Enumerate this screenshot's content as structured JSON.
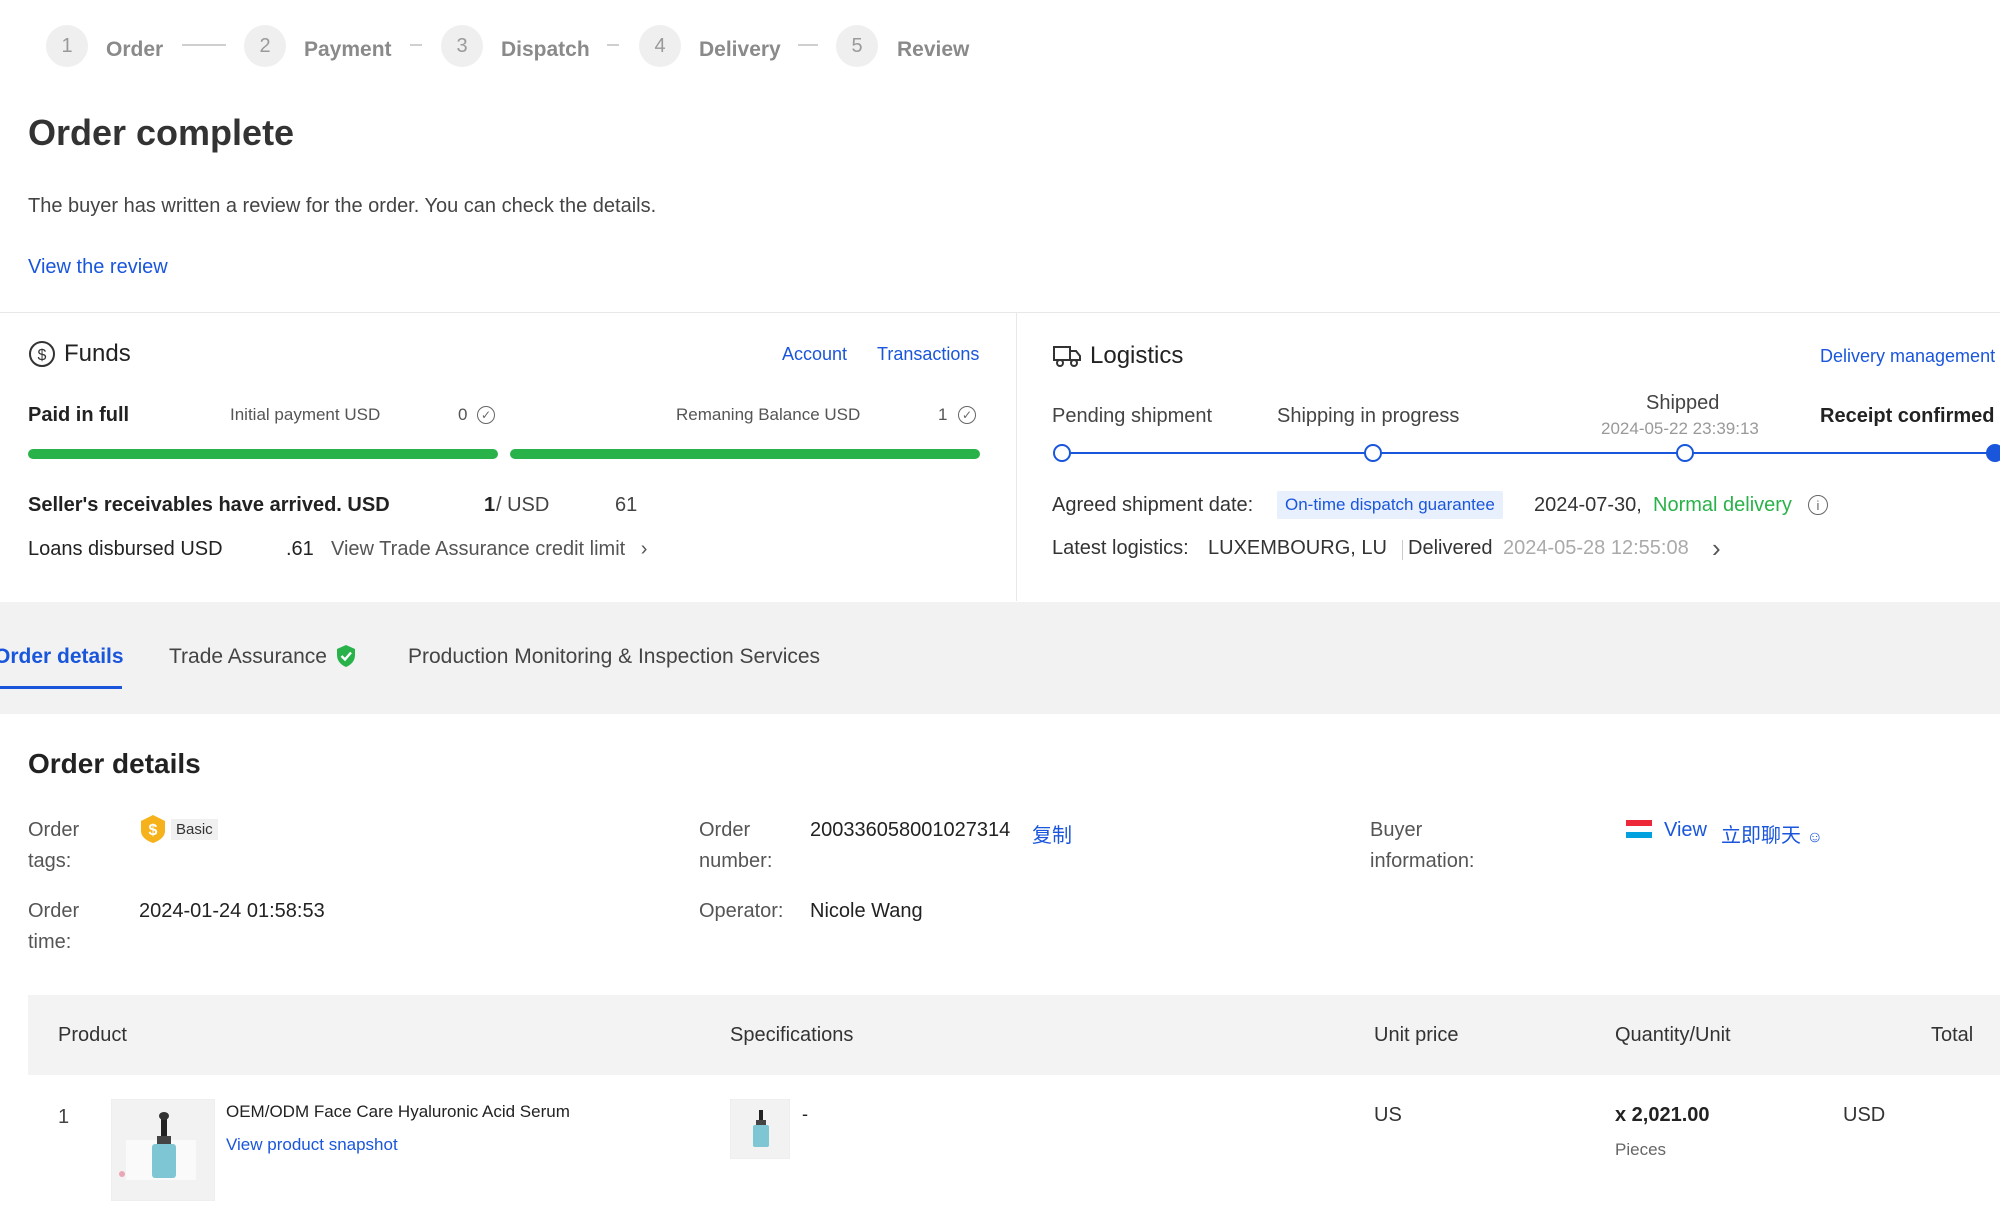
{
  "stepper": {
    "steps": [
      {
        "num": "1",
        "label": "Order"
      },
      {
        "num": "2",
        "label": "Payment"
      },
      {
        "num": "3",
        "label": "Dispatch"
      },
      {
        "num": "4",
        "label": "Delivery"
      },
      {
        "num": "5",
        "label": "Review"
      }
    ]
  },
  "status": {
    "title": "Order complete",
    "description": "The buyer has written a review for the order. You can check the details.",
    "review_link": "View the review"
  },
  "funds": {
    "title": "Funds",
    "account_link": "Account",
    "transactions_link": "Transactions",
    "paid_label": "Paid in full",
    "initial_payment": "Initial payment  USD",
    "initial_value": "0",
    "remaining_balance": "Remaning Balance  USD",
    "remaining_value": "1",
    "receivables": "Seller's receivables have arrived. USD",
    "receivables_value": "1",
    "receivables_usd": "/ USD",
    "receivables_tail": "61",
    "loans": "Loans disbursed USD",
    "loans_value": ".61",
    "credit_link": "View Trade Assurance credit limit",
    "bar_color": "#2ab24a"
  },
  "logistics": {
    "title": "Logistics",
    "delivery_link": "Delivery management",
    "stages": [
      "Pending shipment",
      "Shipping in progress",
      "Shipped",
      "Receipt confirmed"
    ],
    "shipped_time": "2024-05-22 23:39:13",
    "agreed_label": "Agreed shipment date:",
    "guarantee_badge": "On-time dispatch guarantee",
    "agreed_date": "2024-07-30,",
    "normal_delivery": "Normal delivery",
    "latest_label": "Latest logistics:",
    "latest_location": "LUXEMBOURG, LU",
    "latest_status": "Delivered",
    "latest_time": "2024-05-28 12:55:08"
  },
  "tabs": [
    {
      "label": "Order details"
    },
    {
      "label": "Trade Assurance"
    },
    {
      "label": "Production Monitoring & Inspection Services"
    }
  ],
  "order_details": {
    "heading": "Order details",
    "tags_label": "Order tags:",
    "tag_basic": "Basic",
    "number_label": "Order number:",
    "number_value": "200336058001027314",
    "copy_link": "复制",
    "buyer_label": "Buyer information:",
    "view_link": "View",
    "chat_link": "立即聊天",
    "time_label": "Order time:",
    "time_value": "2024-01-24 01:58:53",
    "operator_label": "Operator:",
    "operator_value": "Nicole Wang"
  },
  "table": {
    "headers": [
      "Product",
      "Specifications",
      "Unit price",
      "Quantity/Unit",
      "Total"
    ],
    "rows": [
      {
        "index": "1",
        "name": "OEM/ODM Face Care Hyaluronic Acid Serum",
        "snapshot_link": "View product snapshot",
        "spec": "-",
        "unit_price": "US",
        "quantity": "x 2,021.00",
        "unit": "Pieces",
        "total": "USD"
      }
    ]
  }
}
